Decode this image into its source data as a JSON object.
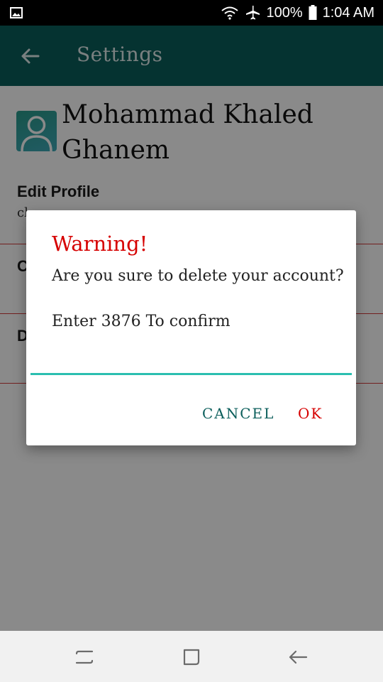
{
  "status_bar": {
    "battery": "100%",
    "time": "1:04 AM"
  },
  "app_bar": {
    "title": "Settings"
  },
  "profile": {
    "name": "Mohammad Khaled Ghanem"
  },
  "sections": [
    {
      "label": "Edit Profile",
      "value": "cl"
    },
    {
      "label": "C"
    },
    {
      "label": "D"
    }
  ],
  "dialog": {
    "title": "Warning!",
    "message": "Are you sure to delete your account?",
    "prompt": "Enter 3876 To confirm",
    "input_value": "",
    "cancel_label": "CANCEL",
    "ok_label": "OK"
  },
  "colors": {
    "app_bar": "#0b5e5b",
    "warning": "#d60000",
    "input_underline": "#2bbfb0",
    "divider": "#d33a3a"
  },
  "icons": {
    "status_left": "gallery-icon",
    "wifi": "wifi-icon",
    "airplane": "airplane-icon",
    "battery": "battery-icon",
    "back": "back-arrow-icon",
    "avatar": "user-avatar-icon",
    "nav_recent": "recent-apps-icon",
    "nav_home": "home-icon",
    "nav_back": "nav-back-icon"
  }
}
